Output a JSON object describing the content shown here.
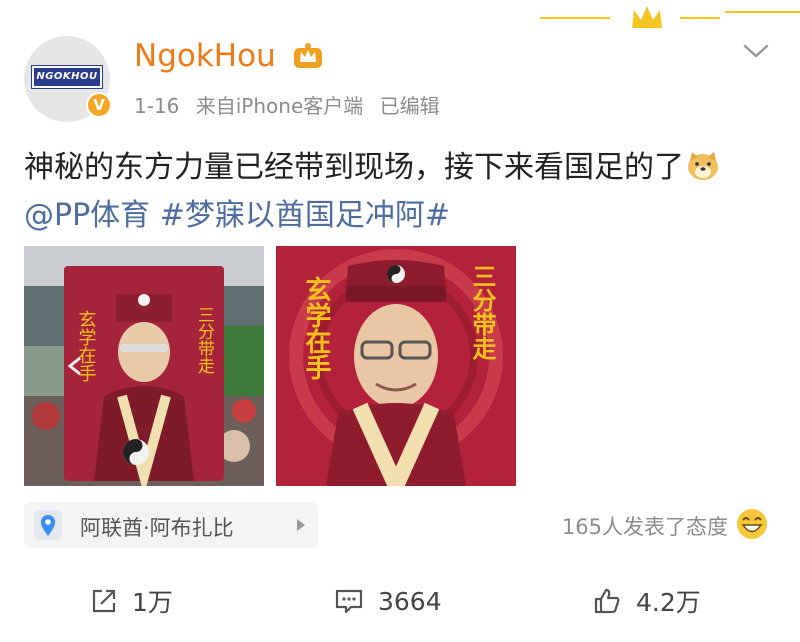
{
  "user": {
    "name": "NgokHou",
    "avatar_logo_text": "NGOKHOU",
    "verified_badge": "V"
  },
  "meta": {
    "date": "1-16",
    "source": "来自iPhone客户端",
    "edited": "已编辑"
  },
  "post": {
    "text": "神秘的东方力量已经带到现场，接下来看国足的了",
    "mention": "@PP体育",
    "hashtag": "#梦寐以酋国足冲阿#"
  },
  "images": [
    {
      "poster_left_text": "玄学在手",
      "poster_right_text": "三分带走"
    },
    {
      "poster_left_text": "玄学在手",
      "poster_right_text": "三分带走"
    }
  ],
  "location": {
    "label": "阿联酋·阿布扎比",
    "icon": "location-pin-icon"
  },
  "reactions": {
    "text": "165人发表了态度",
    "icon": "laughing-emoji-icon"
  },
  "actions": {
    "repost_count": "1万",
    "comment_count": "3664",
    "like_count": "4.2万"
  },
  "colors": {
    "username": "#f07a18",
    "link": "#4e6d9e",
    "poster_red": "#b3223a",
    "poster_text": "#f4c21c"
  }
}
